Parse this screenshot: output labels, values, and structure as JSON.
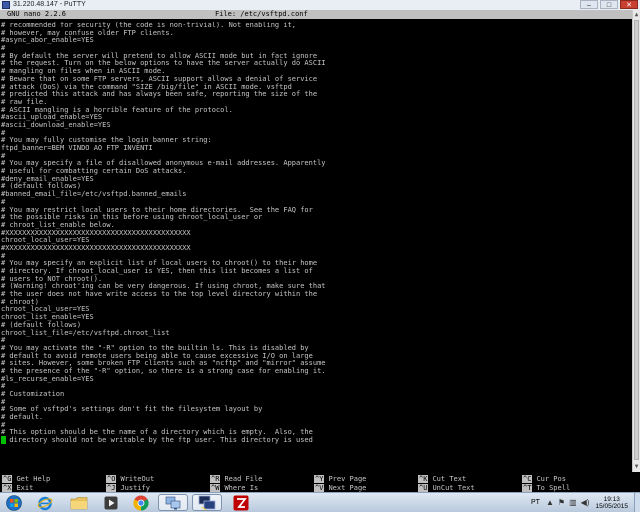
{
  "window": {
    "title": "31.220.48.147 - PuTTY",
    "controls": {
      "minimize": "–",
      "maximize": "□",
      "close": "✕"
    }
  },
  "nano": {
    "version": "GNU nano 2.2.6",
    "file": "File: /etc/vsftpd.conf"
  },
  "editor_lines": [
    "# recommended for security (the code is non-trivial). Not enabling it,",
    "# however, may confuse older FTP clients.",
    "#async_abor_enable=YES",
    "#",
    "# By default the server will pretend to allow ASCII mode but in fact ignore",
    "# the request. Turn on the below options to have the server actually do ASCII",
    "# mangling on files when in ASCII mode.",
    "# Beware that on some FTP servers, ASCII support allows a denial of service",
    "# attack (DoS) via the command \"SIZE /big/file\" in ASCII mode. vsftpd",
    "# predicted this attack and has always been safe, reporting the size of the",
    "# raw file.",
    "# ASCII mangling is a horrible feature of the protocol.",
    "#ascii_upload_enable=YES",
    "#ascii_download_enable=YES",
    "#",
    "# You may fully customise the login banner string:",
    "ftpd_banner=BEM VINDO AO FTP INVENTI",
    "#",
    "# You may specify a file of disallowed anonymous e-mail addresses. Apparently",
    "# useful for combatting certain DoS attacks.",
    "#deny_email_enable=YES",
    "# (default follows)",
    "#banned_email_file=/etc/vsftpd.banned_emails",
    "#",
    "# You may restrict local users to their home directories.  See the FAQ for",
    "# the possible risks in this before using chroot_local_user or",
    "# chroot_list_enable below.",
    "#XXXXXXXXXXXXXXXXXXXXXXXXXXXXXXXXXXXXXXXXXXXX",
    "chroot_local_user=YES",
    "#XXXXXXXXXXXXXXXXXXXXXXXXXXXXXXXXXXXXXXXXXXXX",
    "#",
    "# You may specify an explicit list of local users to chroot() to their home",
    "# directory. If chroot_local_user is YES, then this list becomes a list of",
    "# users to NOT chroot().",
    "# (Warning! chroot'ing can be very dangerous. If using chroot, make sure that",
    "# the user does not have write access to the top level directory within the",
    "# chroot)",
    "chroot_local_user=YES",
    "chroot_list_enable=YES",
    "# (default follows)",
    "chroot_list_file=/etc/vsftpd.chroot_list",
    "#",
    "# You may activate the \"-R\" option to the builtin ls. This is disabled by",
    "# default to avoid remote users being able to cause excessive I/O on large",
    "# sites. However, some broken FTP clients such as \"ncftp\" and \"mirror\" assume",
    "# the presence of the \"-R\" option, so there is a strong case for enabling it.",
    "#ls_recurse_enable=YES",
    "#",
    "# Customization",
    "#",
    "# Some of vsftpd's settings don't fit the filesystem layout by",
    "# default.",
    "#",
    "# This option should be the name of a directory which is empty.  Also, the",
    "# directory should not be writable by the ftp user. This directory is used"
  ],
  "shortcuts": [
    {
      "key": "^G",
      "label": "Get Help"
    },
    {
      "key": "^O",
      "label": "WriteOut"
    },
    {
      "key": "^R",
      "label": "Read File"
    },
    {
      "key": "^Y",
      "label": "Prev Page"
    },
    {
      "key": "^K",
      "label": "Cut Text"
    },
    {
      "key": "^C",
      "label": "Cur Pos"
    },
    {
      "key": "^X",
      "label": "Exit"
    },
    {
      "key": "^J",
      "label": "Justify"
    },
    {
      "key": "^W",
      "label": "Where Is"
    },
    {
      "key": "^V",
      "label": "Next Page"
    },
    {
      "key": "^U",
      "label": "UnCut Text"
    },
    {
      "key": "^T",
      "label": "To Spell"
    }
  ],
  "taskbar": {
    "language": "PT",
    "time": "19:13",
    "date": "15/05/2015",
    "apps": [
      "start-orb",
      "internet-explorer",
      "file-explorer",
      "media-player",
      "chrome",
      "network-app",
      "putty",
      "filezilla"
    ]
  }
}
